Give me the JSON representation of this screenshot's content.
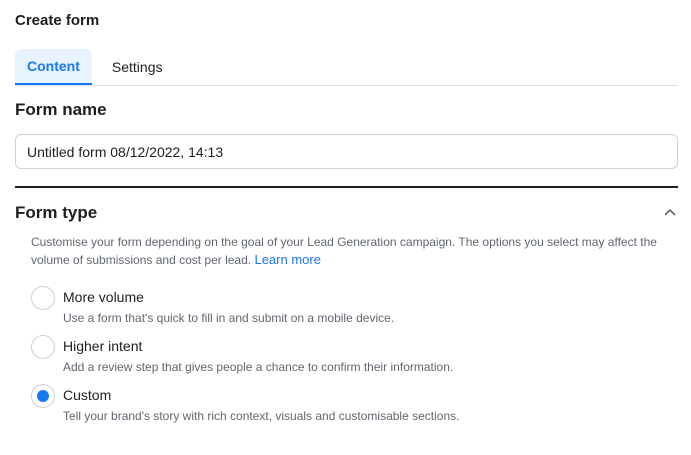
{
  "header": {
    "title": "Create form"
  },
  "tabs": [
    {
      "label": "Content",
      "active": true
    },
    {
      "label": "Settings",
      "active": false
    }
  ],
  "form_name": {
    "title": "Form name",
    "value": "Untitled form 08/12/2022, 14:13"
  },
  "form_type": {
    "title": "Form type",
    "collapse_icon": "chevron-up-icon",
    "description": "Customise your form depending on the goal of your Lead Generation campaign. The options you select may affect the volume of submissions and cost per lead.",
    "learn_more": "Learn more",
    "options": [
      {
        "label": "More volume",
        "description": "Use a form that's quick to fill in and submit on a mobile device.",
        "selected": false
      },
      {
        "label": "Higher intent",
        "description": "Add a review step that gives people a chance to confirm their information.",
        "selected": false
      },
      {
        "label": "Custom",
        "description": "Tell your brand's story with rich context, visuals and customisable sections.",
        "selected": true
      }
    ]
  },
  "colors": {
    "accent": "#1877f2",
    "tab_active_bg": "#e7f3ff",
    "text_primary": "#1c1e21",
    "text_secondary": "#606770",
    "border": "#ccd0d5"
  }
}
